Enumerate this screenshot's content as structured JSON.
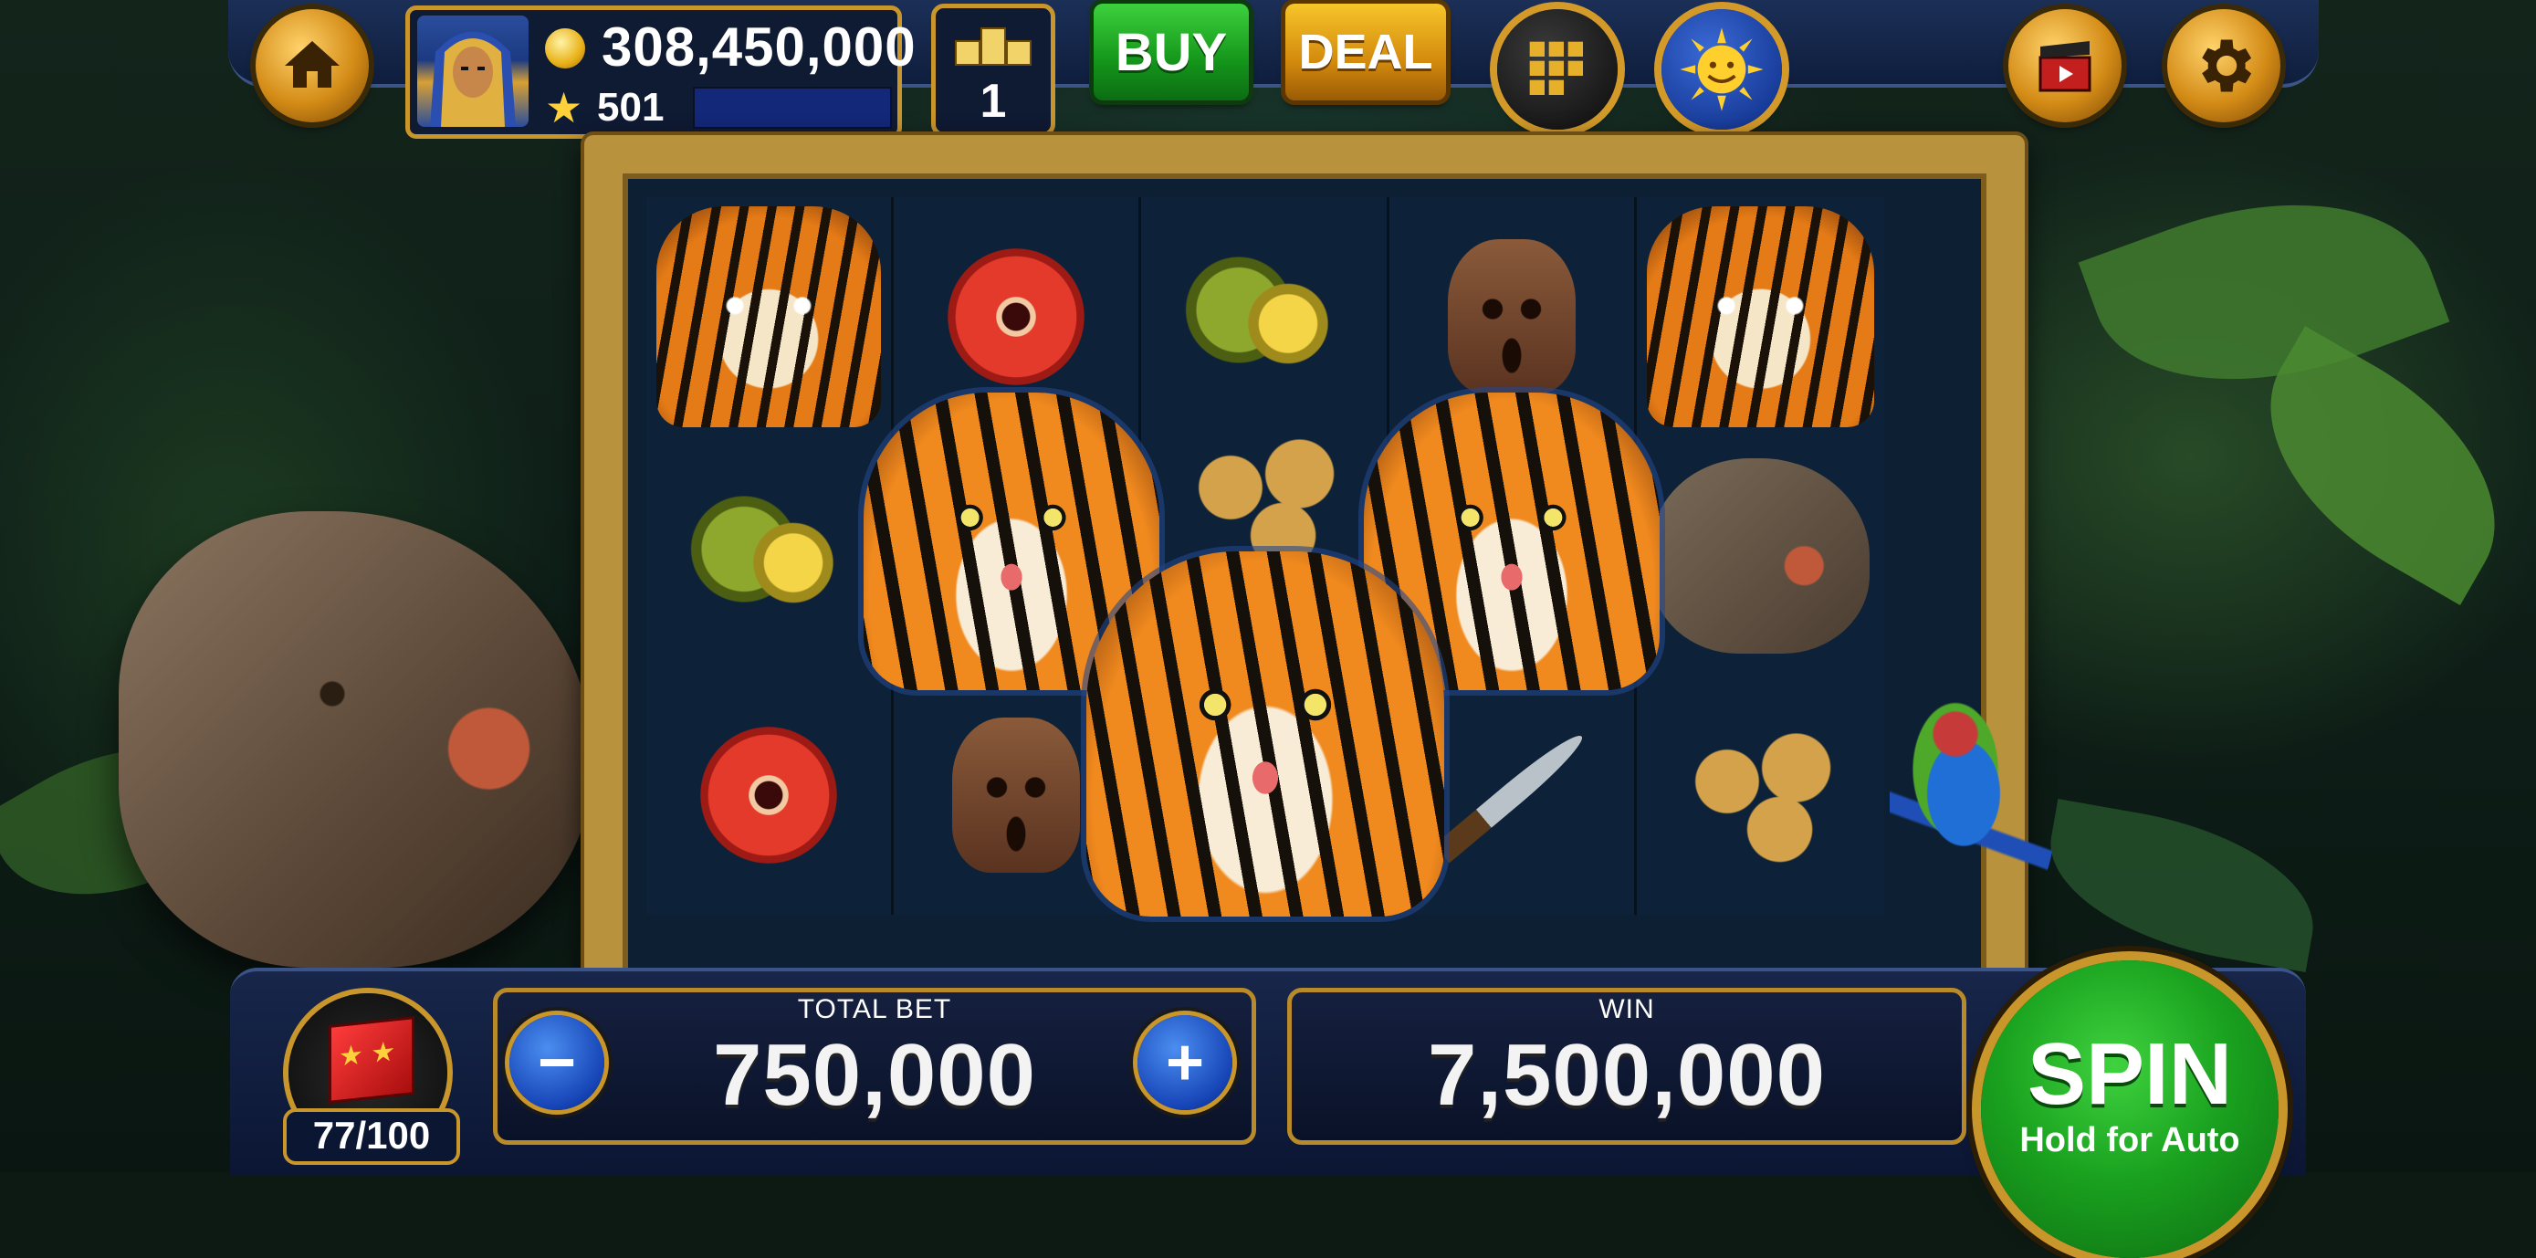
{
  "player": {
    "coins": "308,450,000",
    "level": "501",
    "xp_progress": 0.0
  },
  "rank": {
    "value": "1"
  },
  "buttons": {
    "buy_label": "BUY",
    "deal_label": "DEAL"
  },
  "reels": [
    [
      "tiger",
      "flower",
      "durian",
      "mask",
      "tiger"
    ],
    [
      "durian",
      "tiger-big",
      "coins",
      "tiger-big",
      "rhino"
    ],
    [
      "flower",
      "mask",
      "tiger-big",
      "dagger",
      "coins"
    ]
  ],
  "gift": {
    "count": "77/100"
  },
  "bet": {
    "label": "TOTAL BET",
    "value": "750,000",
    "minus_label": "−",
    "plus_label": "+"
  },
  "win": {
    "label": "WIN",
    "value": "7,500,000"
  },
  "spin": {
    "label": "SPIN",
    "sublabel": "Hold for Auto"
  },
  "colors": {
    "gold": "#c9962c",
    "spin_green": "#1aa21f",
    "buy_green": "#14951a",
    "bar_navy": "#0f1e3d"
  }
}
